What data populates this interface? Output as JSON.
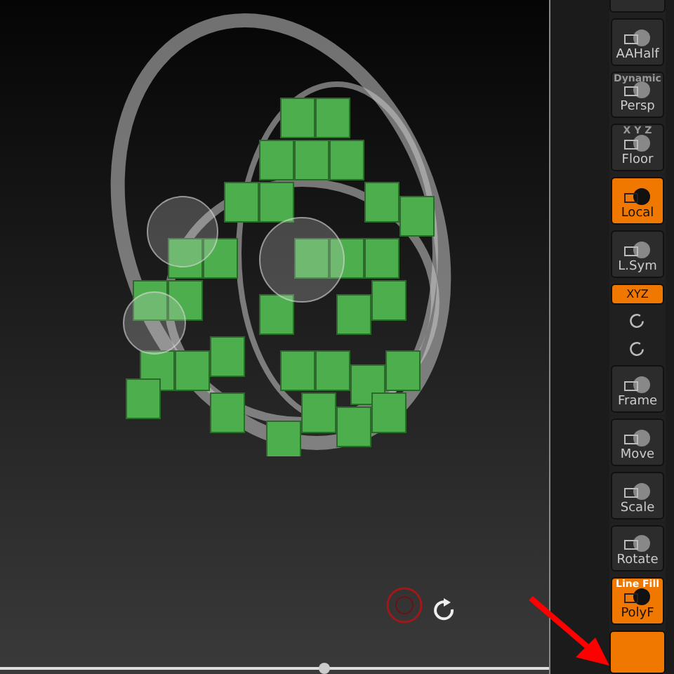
{
  "timeline": {
    "level": 0.59
  },
  "toolbar": [
    {
      "kind": "partial",
      "active": false
    },
    {
      "kind": "button",
      "label": "AAHalf",
      "active": false
    },
    {
      "kind": "button",
      "label": "Persp",
      "top_label": "Dynamic",
      "active": false
    },
    {
      "kind": "button",
      "label": "Floor",
      "top_label": "X Y Z",
      "active": false
    },
    {
      "kind": "button",
      "label": "Local",
      "active": true
    },
    {
      "kind": "button",
      "label": "L.Sym",
      "active": false
    },
    {
      "kind": "small",
      "label": "XYZ",
      "active": true
    },
    {
      "kind": "icon",
      "active": false
    },
    {
      "kind": "icon",
      "active": false
    },
    {
      "kind": "button",
      "label": "Frame",
      "active": false
    },
    {
      "kind": "button",
      "label": "Move",
      "active": false
    },
    {
      "kind": "button",
      "label": "Scale",
      "active": false
    },
    {
      "kind": "button",
      "label": "Rotate",
      "active": false
    },
    {
      "kind": "button",
      "label": "PolyF",
      "top_label": "Line Fill",
      "active": true
    },
    {
      "kind": "partial",
      "active": true
    }
  ]
}
